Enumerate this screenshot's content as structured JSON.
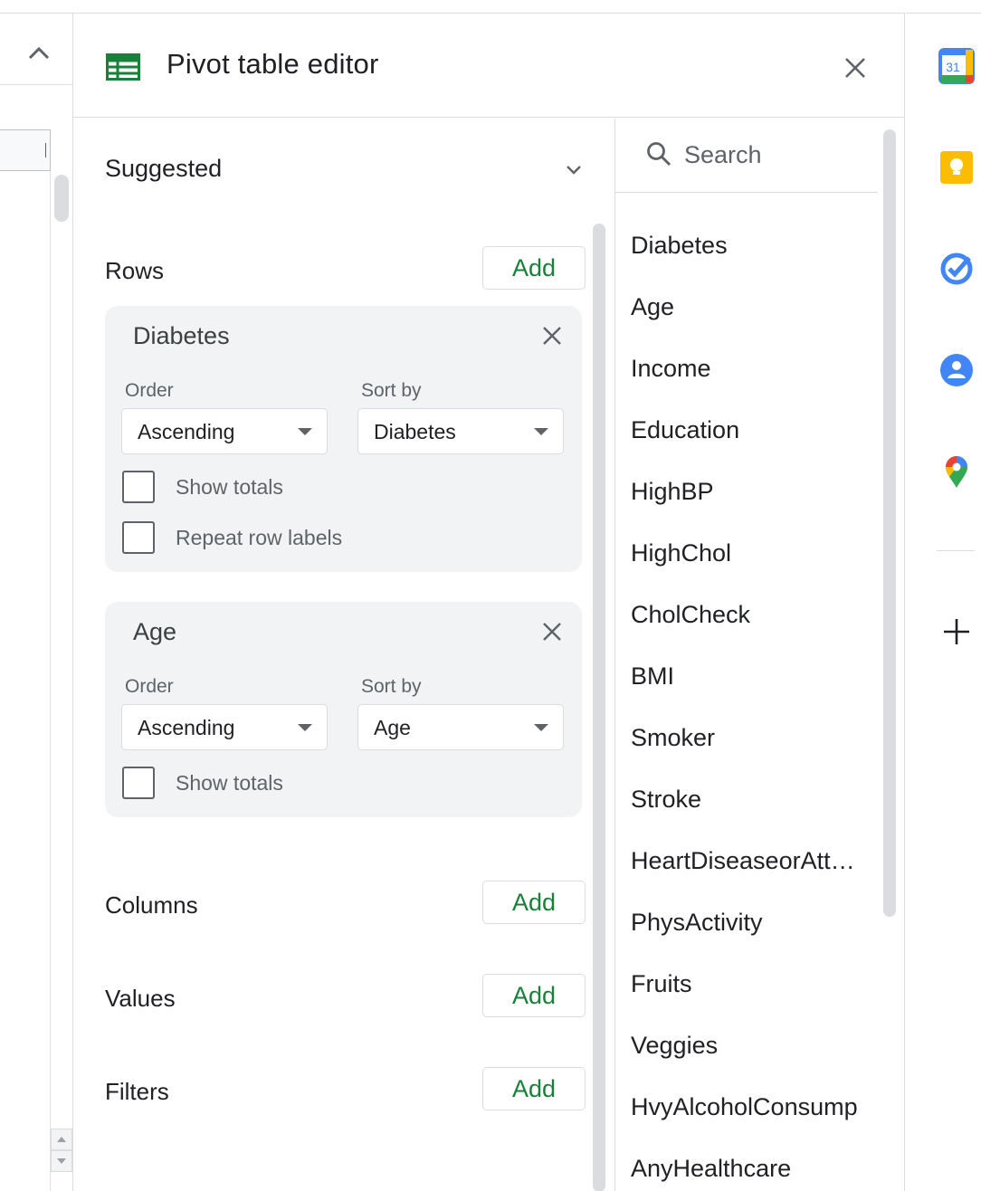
{
  "editor": {
    "title": "Pivot table editor",
    "suggested_label": "Suggested"
  },
  "sections": {
    "rows_label": "Rows",
    "columns_label": "Columns",
    "values_label": "Values",
    "filters_label": "Filters",
    "add_label": "Add"
  },
  "row_cards": [
    {
      "title": "Diabetes",
      "order_label": "Order",
      "order_value": "Ascending",
      "sortby_label": "Sort by",
      "sortby_value": "Diabetes",
      "show_totals_label": "Show totals",
      "show_totals_checked": false,
      "repeat_labels_label": "Repeat row labels",
      "repeat_labels_checked": false
    },
    {
      "title": "Age",
      "order_label": "Order",
      "order_value": "Ascending",
      "sortby_label": "Sort by",
      "sortby_value": "Age",
      "show_totals_label": "Show totals",
      "show_totals_checked": false
    }
  ],
  "fields": {
    "search_placeholder": "Search",
    "items": [
      "Diabetes",
      "Age",
      "Income",
      "Education",
      "HighBP",
      "HighChol",
      "CholCheck",
      "BMI",
      "Smoker",
      "Stroke",
      "HeartDiseaseorAttack",
      "PhysActivity",
      "Fruits",
      "Veggies",
      "HvyAlcoholConsump",
      "AnyHealthcare"
    ]
  },
  "rail": {
    "calendar_day": "31",
    "apps": [
      "calendar-icon",
      "keep-icon",
      "tasks-icon",
      "contacts-icon",
      "maps-icon"
    ]
  },
  "colors": {
    "accent_green": "#188038",
    "card_bg": "#f1f3f4",
    "border": "#dadce0"
  }
}
